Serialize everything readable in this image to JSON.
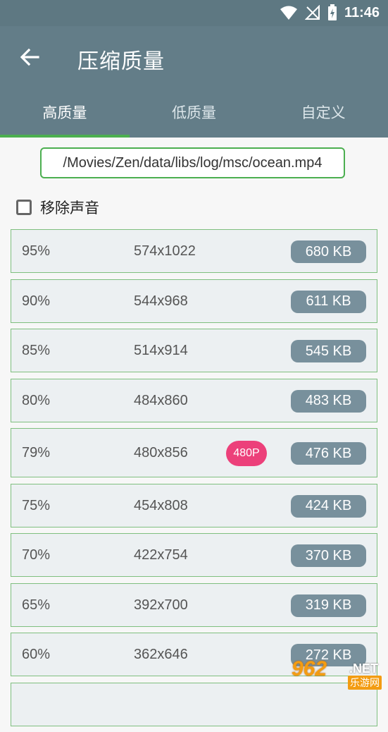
{
  "status": {
    "time": "11:46"
  },
  "appbar": {
    "title": "压缩质量"
  },
  "tabs": [
    {
      "label": "高质量",
      "active": true
    },
    {
      "label": "低质量",
      "active": false
    },
    {
      "label": "自定义",
      "active": false
    }
  ],
  "file_path": "/Movies/Zen/data/libs/log/msc/ocean.mp4",
  "remove_audio": {
    "label": "移除声音",
    "checked": false
  },
  "rows": [
    {
      "percent": "95%",
      "resolution": "574x1022",
      "size": "680 KB"
    },
    {
      "percent": "90%",
      "resolution": "544x968",
      "size": "611 KB"
    },
    {
      "percent": "85%",
      "resolution": "514x914",
      "size": "545 KB"
    },
    {
      "percent": "80%",
      "resolution": "484x860",
      "size": "483 KB"
    },
    {
      "percent": "79%",
      "resolution": "480x856",
      "size": "476 KB",
      "badge": "480P"
    },
    {
      "percent": "75%",
      "resolution": "454x808",
      "size": "424 KB"
    },
    {
      "percent": "70%",
      "resolution": "422x754",
      "size": "370 KB"
    },
    {
      "percent": "65%",
      "resolution": "392x700",
      "size": "319 KB"
    },
    {
      "percent": "60%",
      "resolution": "362x646",
      "size": "272 KB"
    }
  ],
  "watermark": {
    "number": "962",
    "net": ".NET",
    "text": "乐游网"
  },
  "colors": {
    "appbar": "#637d88",
    "accent": "#4caf50",
    "size_chip": "#78909c",
    "badge": "#ec407a"
  },
  "icons": {
    "back": "arrow-left",
    "wifi": "wifi",
    "signal": "no-signal",
    "battery": "battery-charging"
  }
}
